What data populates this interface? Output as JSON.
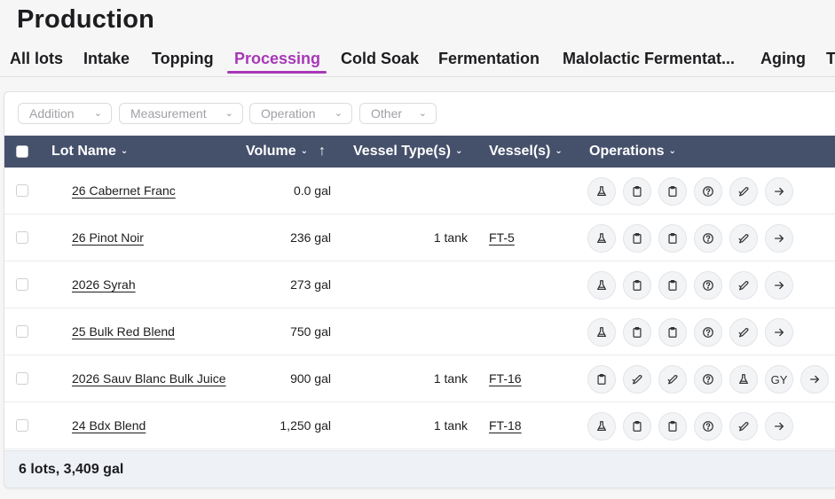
{
  "title": "Production",
  "tabs": [
    {
      "label": "All lots"
    },
    {
      "label": "Intake"
    },
    {
      "label": "Topping"
    },
    {
      "label": "Processing",
      "active": true
    },
    {
      "label": "Cold Soak"
    },
    {
      "label": "Fermentation"
    },
    {
      "label": "Malolactic Fermentat..."
    },
    {
      "label": "Aging"
    },
    {
      "label": "T"
    }
  ],
  "filters": [
    {
      "label": "Addition"
    },
    {
      "label": "Measurement"
    },
    {
      "label": "Operation"
    },
    {
      "label": "Other"
    }
  ],
  "columns": {
    "lot_name": "Lot Name",
    "volume": "Volume",
    "vessel_types": "Vessel Type(s)",
    "vessels": "Vessel(s)",
    "operations": "Operations",
    "sort_arrow": "↑"
  },
  "rows": [
    {
      "name": "26 Cabernet Franc",
      "volume": "0.0 gal",
      "vessel_type": "",
      "vessel": "",
      "ops": [
        "flask",
        "clipboard",
        "clipboard",
        "help",
        "pipette",
        "arrow"
      ]
    },
    {
      "name": "26 Pinot Noir",
      "volume": "236 gal",
      "vessel_type": "1 tank",
      "vessel": "FT-5",
      "ops": [
        "flask",
        "clipboard",
        "clipboard",
        "help",
        "pipette",
        "arrow"
      ]
    },
    {
      "name": "2026 Syrah",
      "volume": "273 gal",
      "vessel_type": "",
      "vessel": "",
      "ops": [
        "flask",
        "clipboard",
        "clipboard",
        "help",
        "pipette",
        "arrow"
      ]
    },
    {
      "name": "25 Bulk Red Blend",
      "volume": "750 gal",
      "vessel_type": "",
      "vessel": "",
      "ops": [
        "flask",
        "clipboard",
        "clipboard",
        "help",
        "pipette",
        "arrow"
      ]
    },
    {
      "name": "2026 Sauv Blanc Bulk Juice",
      "volume": "900 gal",
      "vessel_type": "1 tank",
      "vessel": "FT-16",
      "ops": [
        "clipboard",
        "pipette",
        "pipette",
        "help",
        "flask",
        "GY",
        "arrow"
      ]
    },
    {
      "name": "24 Bdx Blend",
      "volume": "1,250 gal",
      "vessel_type": "1 tank",
      "vessel": "FT-18",
      "ops": [
        "flask",
        "clipboard",
        "clipboard",
        "help",
        "pipette",
        "arrow"
      ]
    }
  ],
  "footer": {
    "summary": "6 lots, 3,409 gal"
  }
}
